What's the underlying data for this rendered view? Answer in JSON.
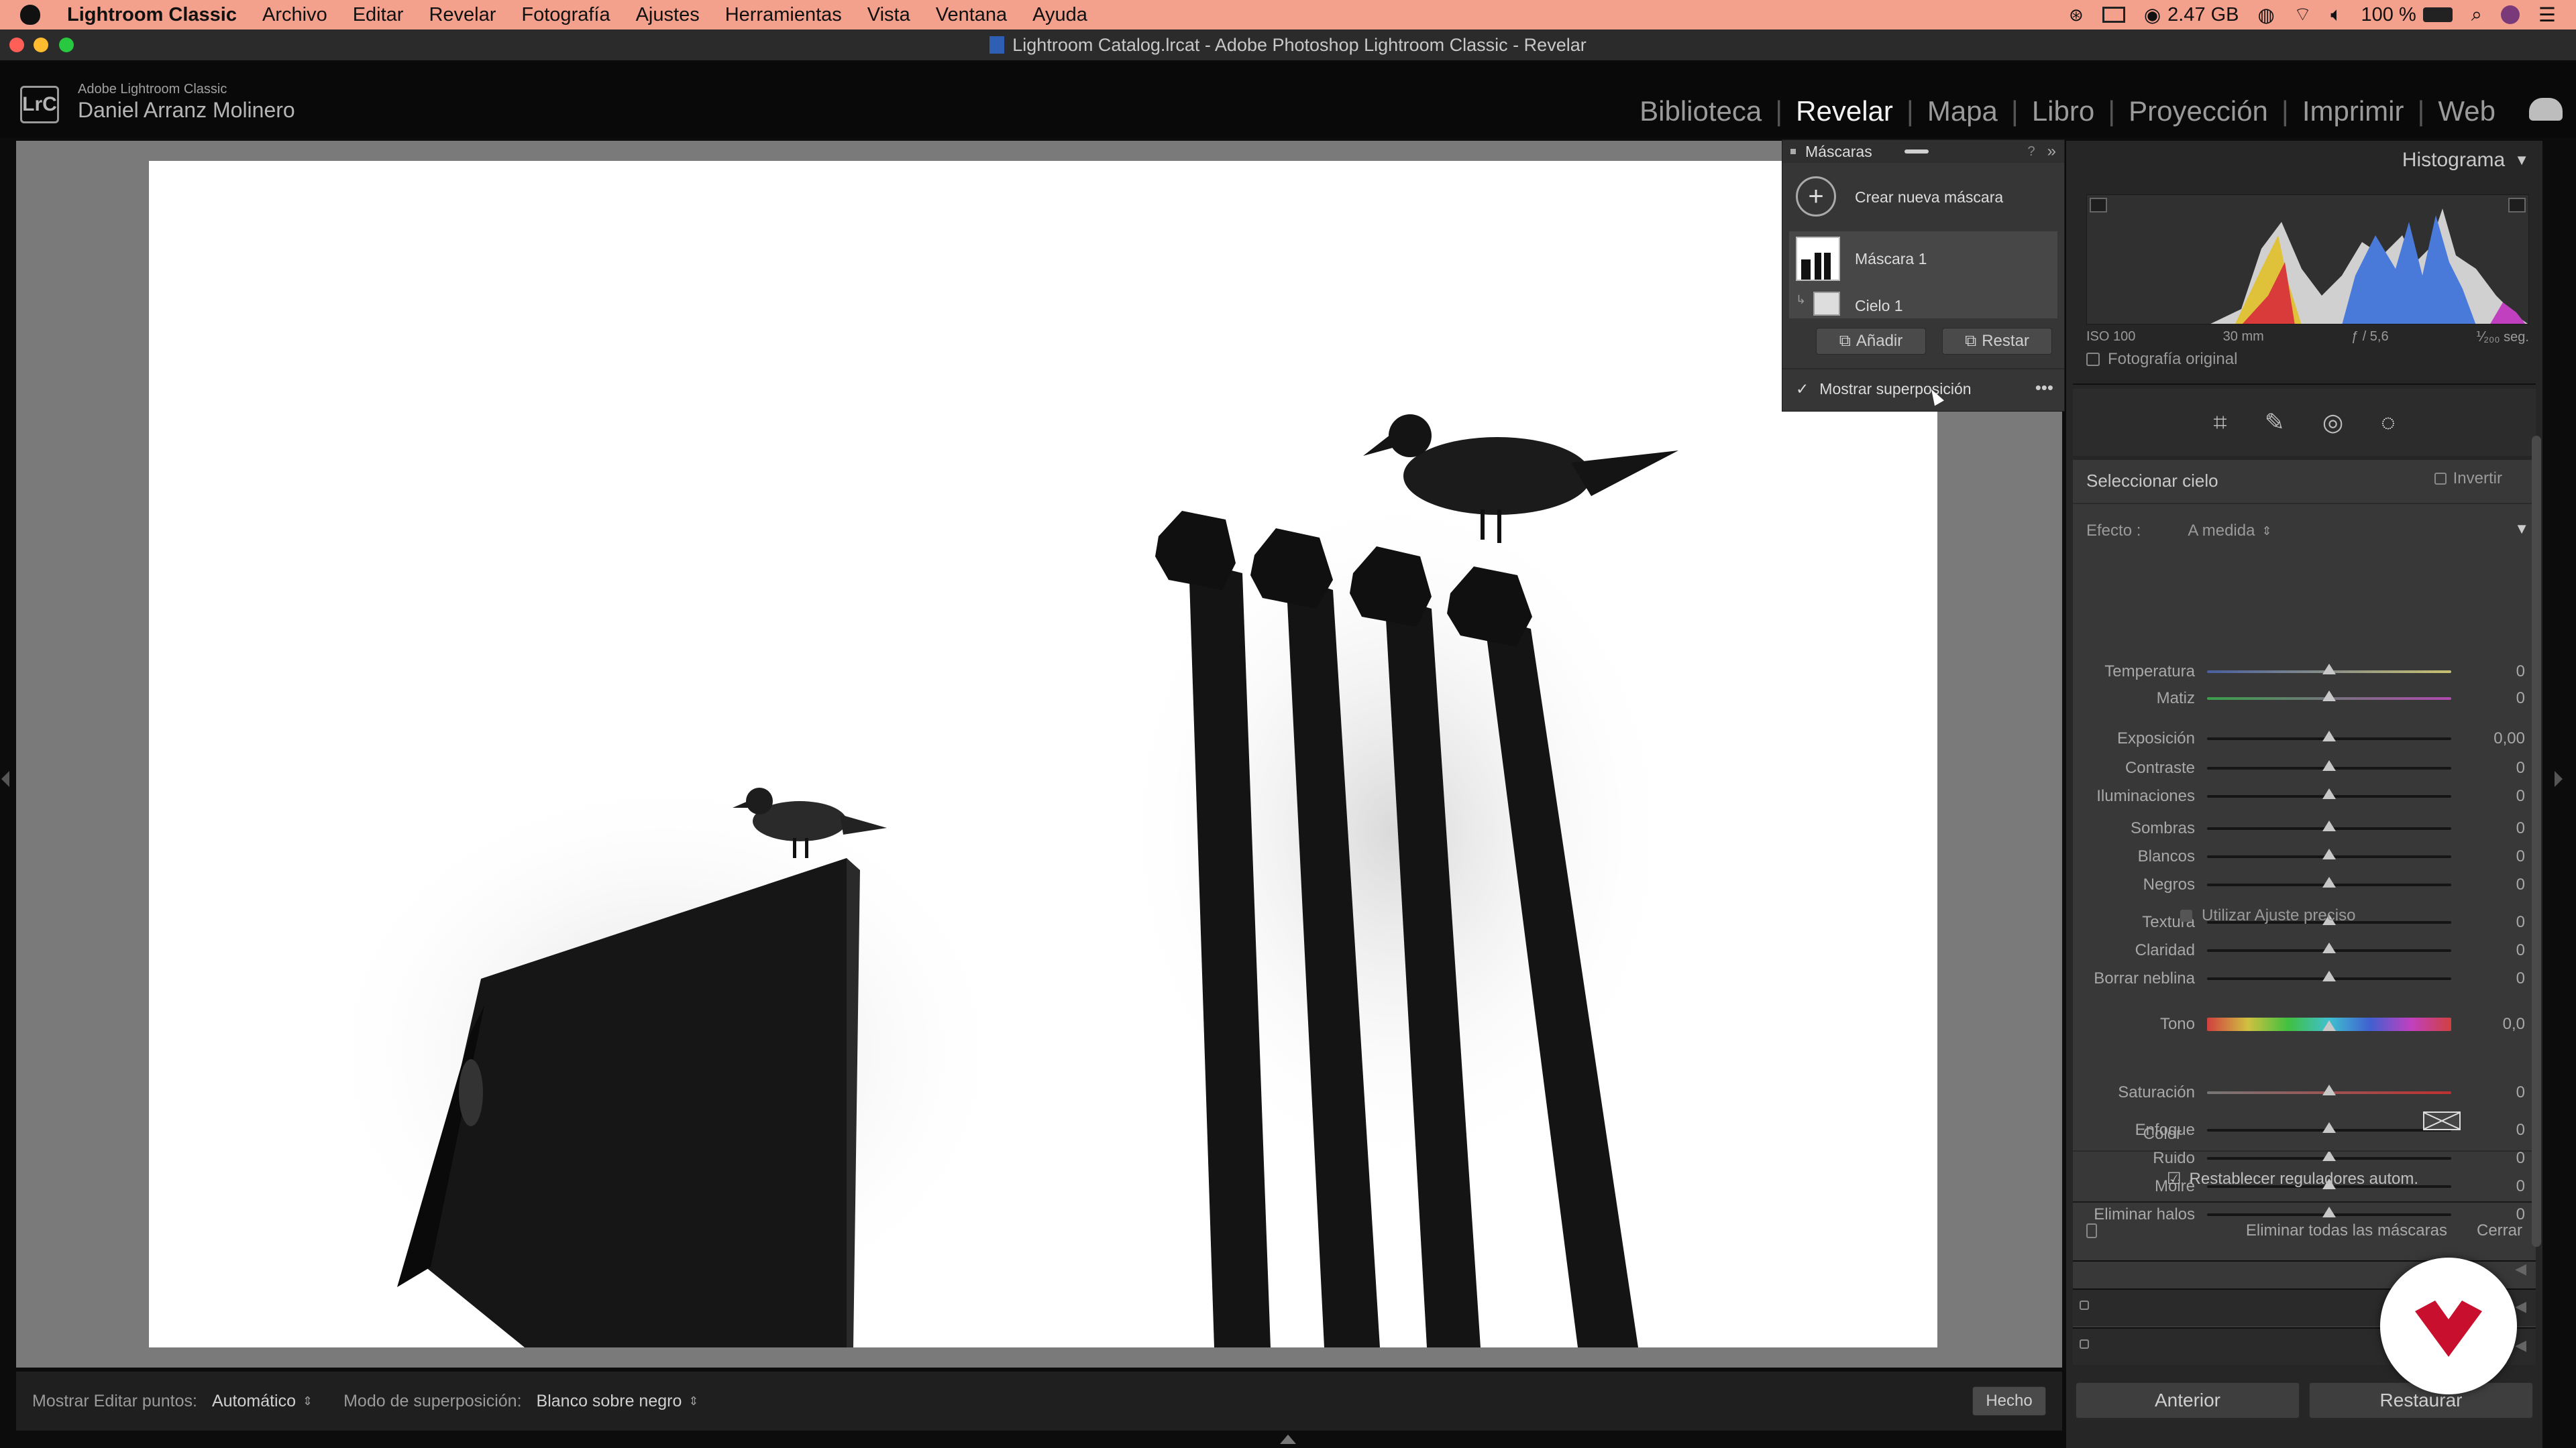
{
  "menubar": {
    "apple": "",
    "app_name": "Lightroom Classic",
    "items": [
      "Archivo",
      "Editar",
      "Revelar",
      "Fotografía",
      "Ajustes",
      "Herramientas",
      "Vista",
      "Ventana",
      "Ayuda"
    ],
    "memory": "2.47 GB",
    "battery": "100 %"
  },
  "window": {
    "title": "Lightroom Catalog.lrcat - Adobe Photoshop Lightroom Classic - Revelar"
  },
  "identity": {
    "logo": "LrC",
    "product": "Adobe Lightroom Classic",
    "user": "Daniel Arranz Molinero",
    "modules": [
      "Biblioteca",
      "Revelar",
      "Mapa",
      "Libro",
      "Proyección",
      "Imprimir",
      "Web"
    ],
    "active_module": "Revelar"
  },
  "masks_panel": {
    "title": "Máscaras",
    "create_label": "Crear nueva máscara",
    "mask_name": "Máscara 1",
    "component_name": "Cielo 1",
    "add_label": "Añadir",
    "subtract_label": "Restar",
    "overlay_label": "Mostrar superposición",
    "overlay_checked": true
  },
  "histogram": {
    "title": "Histograma",
    "iso": "ISO 100",
    "focal": "30 mm",
    "aperture": "ƒ / 5,6",
    "shutter": "⅟₂₀₀ seg.",
    "original_label": "Fotografía original"
  },
  "sky_panel": {
    "title": "Seleccionar cielo",
    "invert_label": "Invertir",
    "effect_label": "Efecto :",
    "effect_value": "A medida",
    "sliders": [
      {
        "label": "Temperatura",
        "value": "0",
        "pos": 0.5
      },
      {
        "label": "Matiz",
        "value": "0",
        "pos": 0.5
      },
      {
        "label": "Exposición",
        "value": "0,00",
        "pos": 0.5
      },
      {
        "label": "Contraste",
        "value": "0",
        "pos": 0.5
      },
      {
        "label": "Iluminaciones",
        "value": "0",
        "pos": 0.5
      },
      {
        "label": "Sombras",
        "value": "0",
        "pos": 0.5
      },
      {
        "label": "Blancos",
        "value": "0",
        "pos": 0.5
      },
      {
        "label": "Negros",
        "value": "0",
        "pos": 0.5
      },
      {
        "label": "Textura",
        "value": "0",
        "pos": 0.5
      },
      {
        "label": "Claridad",
        "value": "0",
        "pos": 0.5
      },
      {
        "label": "Borrar neblina",
        "value": "0",
        "pos": 0.5
      },
      {
        "label": "Tono",
        "value": "0,0",
        "pos": 0.5
      },
      {
        "label": "Saturación",
        "value": "0",
        "pos": 0.5
      },
      {
        "label": "Enfoque",
        "value": "0",
        "pos": 0.5
      },
      {
        "label": "Ruido",
        "value": "0",
        "pos": 0.5
      },
      {
        "label": "Moiré",
        "value": "0",
        "pos": 0.5
      },
      {
        "label": "Eliminar halos",
        "value": "0",
        "pos": 0.5
      }
    ],
    "fine_adjust_label": "Utilizar Ajuste preciso",
    "color_label": "Color",
    "reset_label": "Restablecer reguladores autom.",
    "delete_all_label": "Eliminar todas las máscaras",
    "close_label": "Cerrar"
  },
  "bottom_toolbar": {
    "edit_points_label": "Mostrar Editar puntos:",
    "edit_points_value": "Automático",
    "overlay_mode_label": "Modo de superposición:",
    "overlay_mode_value": "Blanco sobre negro",
    "done_label": "Hecho"
  },
  "footer_buttons": {
    "previous": "Anterior",
    "reset": "Restaurar"
  },
  "colors": {
    "menubar": "#f3a08d",
    "panel": "#262626",
    "accent_red": "#c8102e"
  }
}
